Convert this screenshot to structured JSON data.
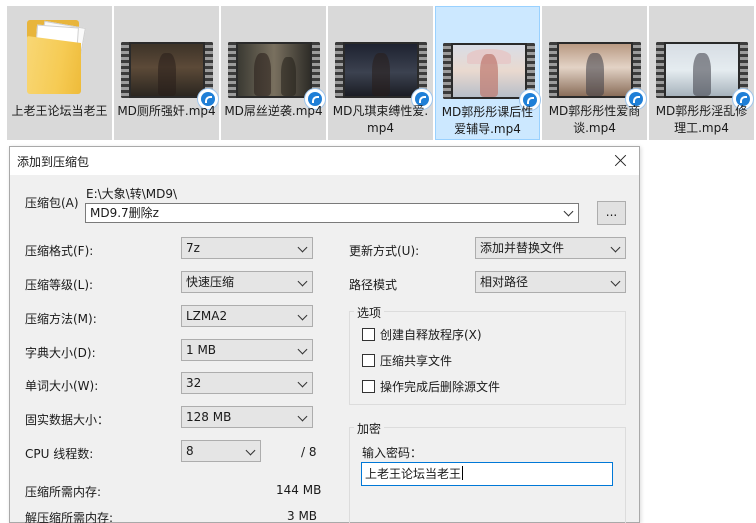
{
  "files": [
    {
      "label": "上老王论坛当老王",
      "kind": "folder"
    },
    {
      "label": "MD厕所强奸.mp4",
      "kind": "video"
    },
    {
      "label": "MD屌丝逆袭.mp4",
      "kind": "video"
    },
    {
      "label": "MD凡琪束缚性爱.mp4",
      "kind": "video"
    },
    {
      "label": "MD郭彤彤课后性爱辅导.mp4",
      "kind": "video",
      "selected": true
    },
    {
      "label": "MD郭彤彤性爱商谈.mp4",
      "kind": "video"
    },
    {
      "label": "MD郭彤彤淫乱修理工.mp4",
      "kind": "video"
    }
  ],
  "dialog": {
    "title": "添加到压缩包",
    "archive": {
      "label": "压缩包(A)",
      "path": "E:\\大象\\转\\MD9\\",
      "name": "MD9.7删除z",
      "browse_label": "..."
    },
    "left": {
      "format_label": "压缩格式(F):",
      "format_value": "7z",
      "level_label": "压缩等级(L):",
      "level_value": "快速压缩",
      "method_label": "压缩方法(M):",
      "method_value": "LZMA2",
      "dict_label": "字典大小(D):",
      "dict_value": "1 MB",
      "word_label": "单词大小(W):",
      "word_value": "32",
      "solid_label": "固实数据大小：",
      "solid_value": "128 MB",
      "cpu_label": "CPU 线程数:",
      "cpu_value": "8",
      "cpu_max": "/ 8",
      "mem_comp_label": "压缩所需内存:",
      "mem_comp_value": "144 MB",
      "mem_decomp_label": "解压缩所需内存:",
      "mem_decomp_value": "3 MB"
    },
    "right": {
      "update_label": "更新方式(U):",
      "update_value": "添加并替换文件",
      "pathmode_label": "路径模式",
      "pathmode_value": "相对路径",
      "options_title": "选项",
      "opt_sfx": "创建自释放程序(X)",
      "opt_shared": "压缩共享文件",
      "opt_delete": "操作完成后删除源文件",
      "encrypt_title": "加密",
      "password_label": "输入密码：",
      "password_value": "上老王论坛当老王"
    }
  }
}
